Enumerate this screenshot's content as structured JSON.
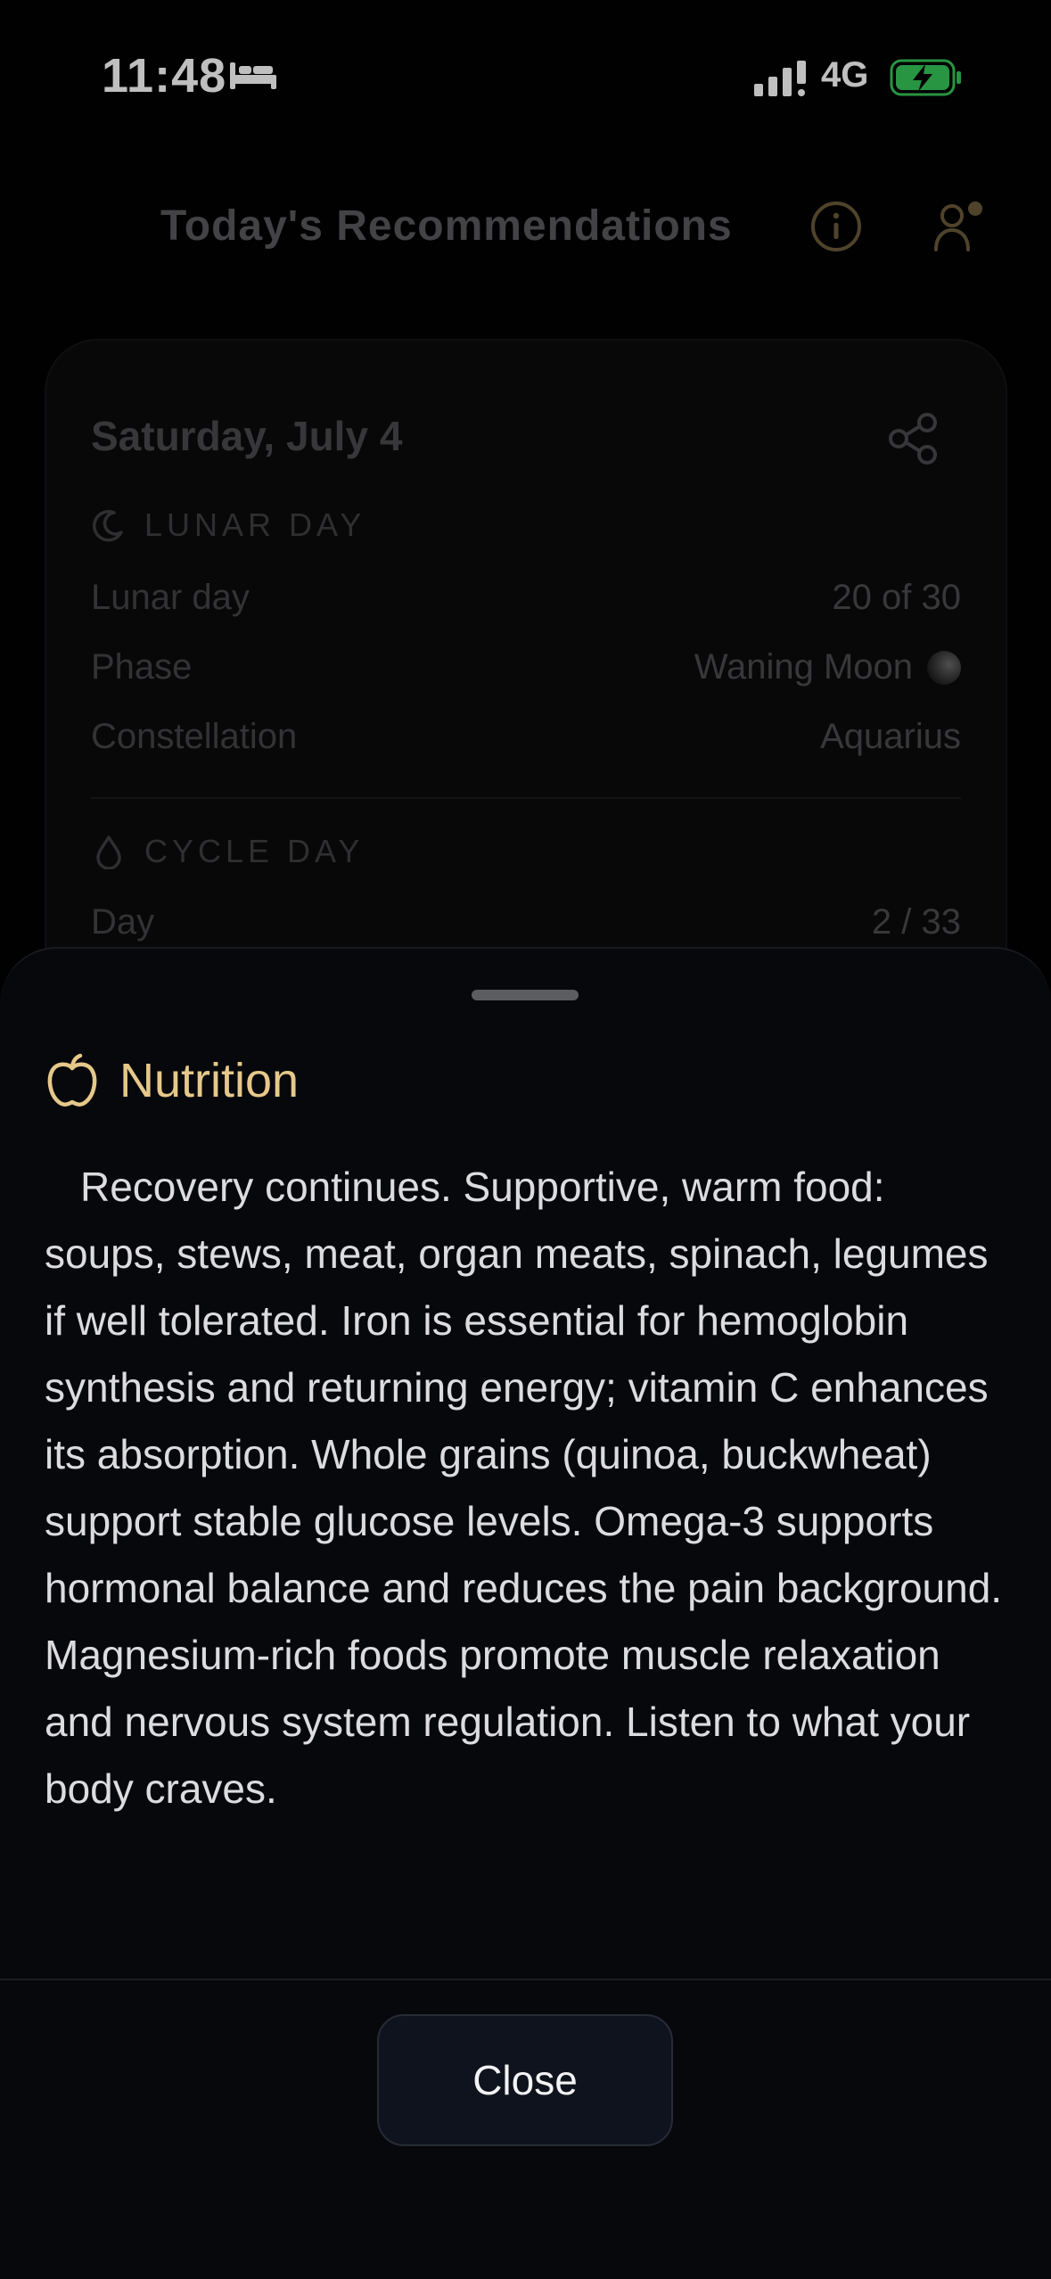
{
  "status_bar": {
    "time": "11:48",
    "network": "4G",
    "icons": [
      "bed-icon",
      "signal-icon",
      "battery-charging-icon"
    ]
  },
  "header": {
    "title": "Today's Recommendations",
    "icons": [
      "info-icon",
      "profile-icon"
    ]
  },
  "day_card": {
    "date": "Saturday, July 4",
    "lunar_section": {
      "label": "LUNAR DAY",
      "icon": "crescent-moon-icon",
      "rows": [
        {
          "label": "Lunar day",
          "value": "20 of 30"
        },
        {
          "label": "Phase",
          "value": "Waning Moon"
        },
        {
          "label": "Constellation",
          "value": "Aquarius"
        }
      ]
    },
    "cycle_section": {
      "label": "CYCLE DAY",
      "icon": "drop-icon",
      "rows": [
        {
          "label": "Day",
          "value": "2 / 33"
        }
      ]
    }
  },
  "sheet": {
    "title": "Nutrition",
    "icon": "apple-icon",
    "body": "Recovery continues. Supportive, warm food: soups, stews, meat, organ meats, spinach, legumes if well tolerated. Iron is essential for hemoglobin synthesis and returning energy; vitamin C enhances its absorption. Whole grains (quinoa, buckwheat) support stable glucose levels. Omega-3 supports hormonal balance and reduces the pain background. Magnesium-rich foods promote muscle relaxation and nervous system regulation. Listen to what your body craves.",
    "close_label": "Close"
  },
  "colors": {
    "accent": "#e5c88a",
    "icon_muted": "#6b5a3a",
    "background": "#020203",
    "sheet": "#07080b",
    "battery": "#34c759"
  }
}
